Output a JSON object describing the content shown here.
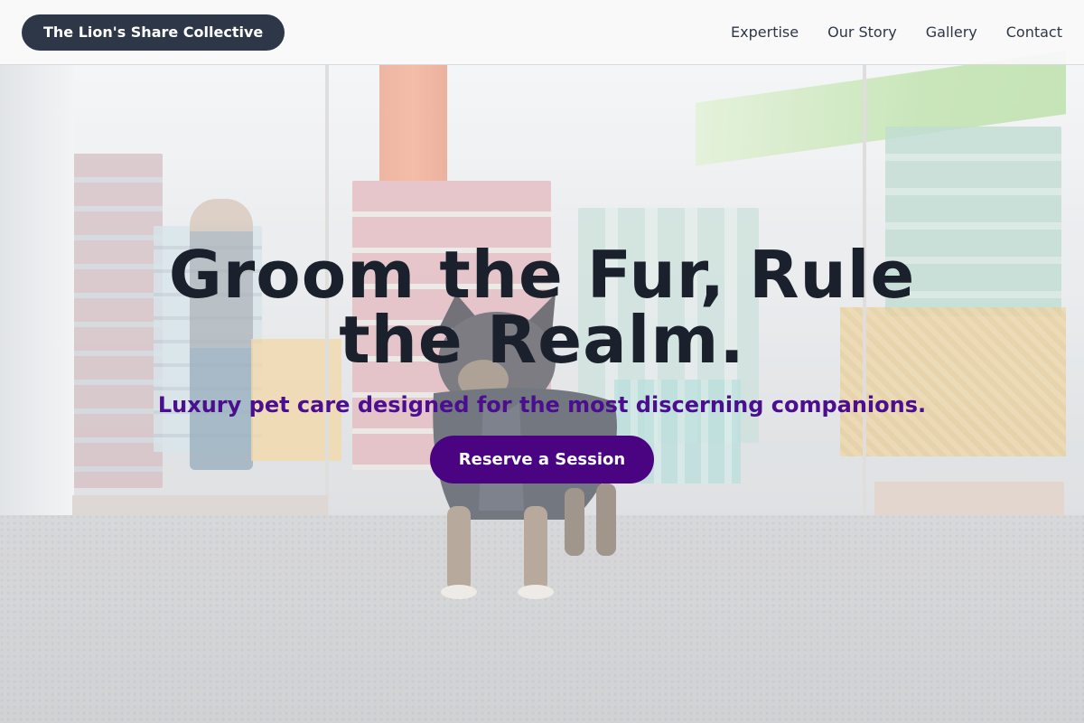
{
  "header": {
    "brand_name": "The Lion's Share Collective",
    "nav_links": [
      {
        "label": "Expertise"
      },
      {
        "label": "Our Story"
      },
      {
        "label": "Gallery"
      },
      {
        "label": "Contact"
      }
    ]
  },
  "hero": {
    "headline": "Groom the Fur, Rule the Realm.",
    "subheadline": "Luxury pet care designed for the most discerning companions.",
    "cta_label": "Reserve a Session",
    "background_image": "pet-store-dog-photo"
  },
  "colors": {
    "brand_bg": "#2d3748",
    "headline": "#1a202c",
    "subheadline": "#4a0e8f",
    "cta_bg": "#4a0482"
  }
}
